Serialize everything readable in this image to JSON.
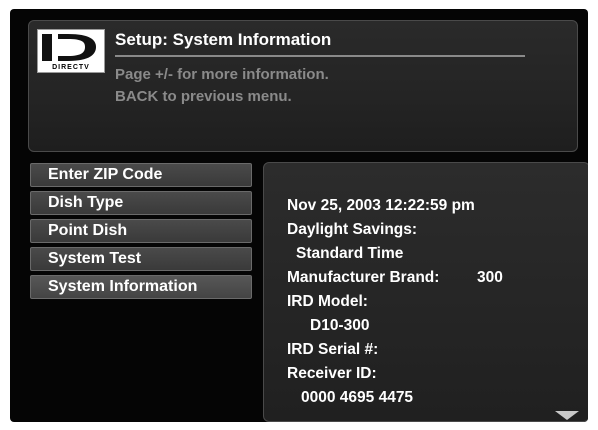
{
  "header": {
    "logo_text": "DIRECTV",
    "title": "Setup: System Information",
    "instructions": [
      "Page +/- for more information.",
      "BACK to previous menu."
    ]
  },
  "menu": {
    "items": [
      {
        "label": "Enter ZIP Code"
      },
      {
        "label": "Dish Type"
      },
      {
        "label": "Point Dish"
      },
      {
        "label": "System Test"
      },
      {
        "label": "System Information",
        "selected": true
      }
    ]
  },
  "info": {
    "datetime": "Nov 25, 2003 12:22:59 pm",
    "daylight_savings_label": "Daylight Savings:",
    "daylight_savings_value": "Standard Time",
    "manufacturer_label": "Manufacturer Brand:",
    "manufacturer_value": "300",
    "ird_model_label": "IRD Model:",
    "ird_model_value": "D10-300",
    "ird_serial_label": "IRD Serial #:",
    "receiver_id_label": "Receiver ID:",
    "receiver_id_value": "0000 4695 4475"
  },
  "scroll_indicator_icon": "down-triangle-icon"
}
